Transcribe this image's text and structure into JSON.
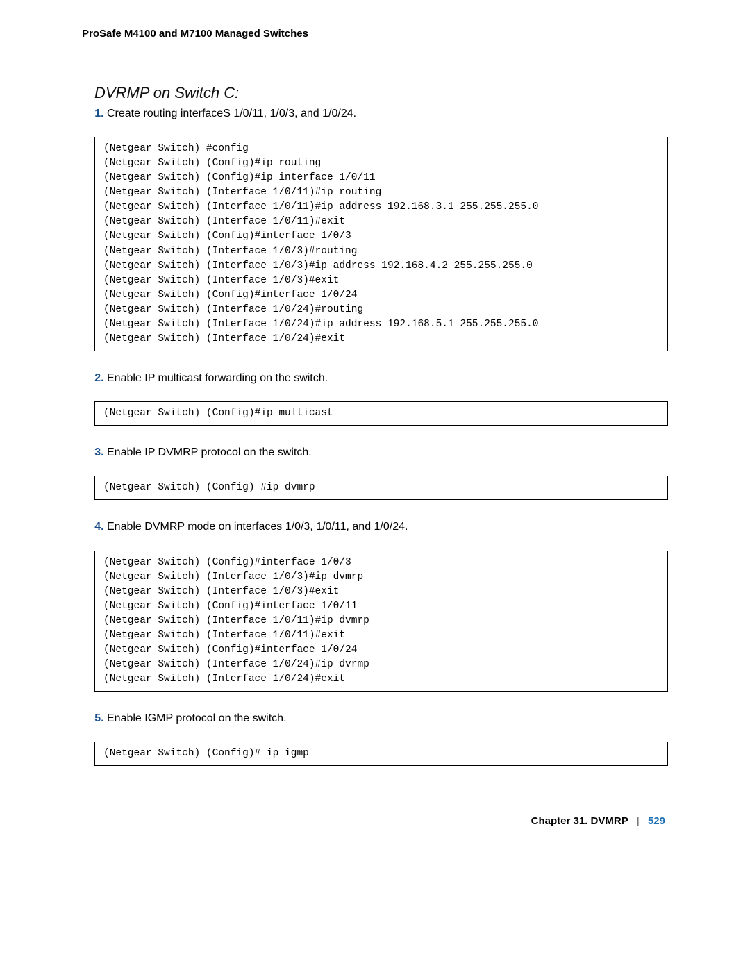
{
  "header": "ProSafe M4100 and M7100 Managed Switches",
  "section_title": "DVRMP on Switch C:",
  "steps": [
    {
      "text": "Create routing interfaceS 1/0/11, 1/0/3, and 1/0/24."
    },
    {
      "text": "Enable IP multicast forwarding on the switch."
    },
    {
      "text": "Enable IP DVMRP protocol on the switch."
    },
    {
      "text": "Enable DVMRP mode on interfaces 1/0/3, 1/0/11, and 1/0/24."
    },
    {
      "text": "Enable IGMP protocol on the switch."
    }
  ],
  "code": {
    "block1": "(Netgear Switch) #config\n(Netgear Switch) (Config)#ip routing\n(Netgear Switch) (Config)#ip interface 1/0/11\n(Netgear Switch) (Interface 1/0/11)#ip routing\n(Netgear Switch) (Interface 1/0/11)#ip address 192.168.3.1 255.255.255.0\n(Netgear Switch) (Interface 1/0/11)#exit\n(Netgear Switch) (Config)#interface 1/0/3\n(Netgear Switch) (Interface 1/0/3)#routing\n(Netgear Switch) (Interface 1/0/3)#ip address 192.168.4.2 255.255.255.0\n(Netgear Switch) (Interface 1/0/3)#exit\n(Netgear Switch) (Config)#interface 1/0/24\n(Netgear Switch) (Interface 1/0/24)#routing\n(Netgear Switch) (Interface 1/0/24)#ip address 192.168.5.1 255.255.255.0\n(Netgear Switch) (Interface 1/0/24)#exit",
    "block2": "(Netgear Switch) (Config)#ip multicast",
    "block3": "(Netgear Switch) (Config) #ip dvmrp",
    "block4": "(Netgear Switch) (Config)#interface 1/0/3\n(Netgear Switch) (Interface 1/0/3)#ip dvmrp\n(Netgear Switch) (Interface 1/0/3)#exit\n(Netgear Switch) (Config)#interface 1/0/11\n(Netgear Switch) (Interface 1/0/11)#ip dvmrp\n(Netgear Switch) (Interface 1/0/11)#exit\n(Netgear Switch) (Config)#interface 1/0/24\n(Netgear Switch) (Interface 1/0/24)#ip dvrmp\n(Netgear Switch) (Interface 1/0/24)#exit",
    "block5": "(Netgear Switch) (Config)# ip igmp"
  },
  "footer": {
    "chapter": "Chapter 31.  DVMRP",
    "separator": "|",
    "page": "529"
  }
}
